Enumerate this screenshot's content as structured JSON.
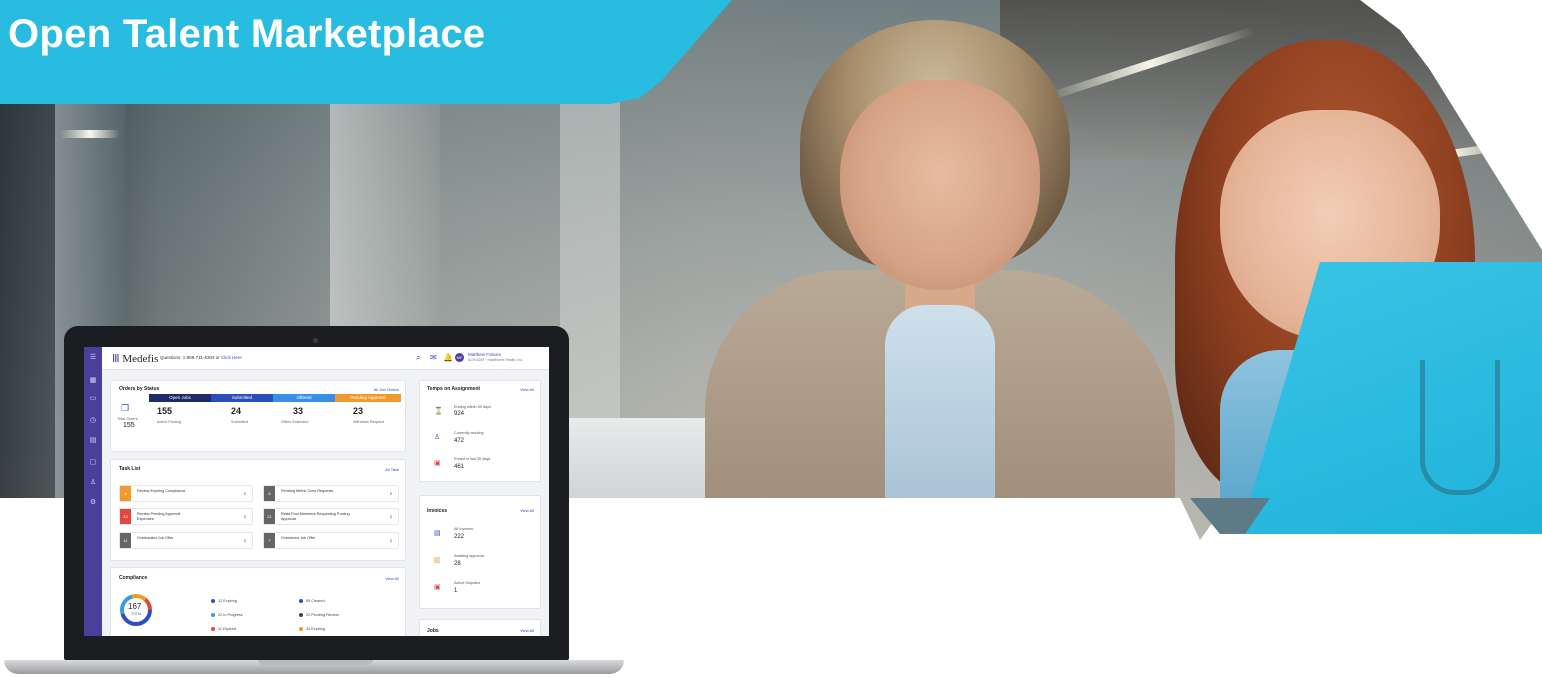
{
  "title": "Open Talent Marketplace",
  "colors": {
    "accent": "#28bde0",
    "rail": "#4a3f9a",
    "link": "#2f4cc4"
  },
  "app": {
    "logo": "Medefis",
    "phone_text": "Questions: 1-866-711-6303 or",
    "click_here": "Click Here",
    "user_name": "Matthew Folsom",
    "user_org": "ACH-6287 · Hawthorne Health, Inc.",
    "avatar_initials": "MF",
    "icons": [
      "search-icon",
      "mail-icon",
      "bell-icon"
    ]
  },
  "sidebar_icons": [
    "grid-icon",
    "briefcase-icon",
    "clock-icon",
    "document-icon",
    "folder-icon",
    "people-icon",
    "gear-icon"
  ],
  "orders": {
    "title": "Orders by Status",
    "link": "All Job Orders",
    "total_label": "Total Orders",
    "total": "155",
    "segments": [
      {
        "label": "Open Jobs",
        "color": "#1f2a6b",
        "value": "155",
        "sub": "Active Posting"
      },
      {
        "label": "Submitted",
        "color": "#2b4fb8",
        "value": "24",
        "sub": "Submitted"
      },
      {
        "label": "Offered",
        "color": "#3a8ee6",
        "value": "33",
        "sub": "Offers Extended"
      },
      {
        "label": "Pending Approval",
        "color": "#f09a2e",
        "value": "23",
        "sub": "Withdraw Request"
      }
    ]
  },
  "tasks": {
    "title": "Task List",
    "link": "All Task",
    "items": [
      {
        "badge": "4",
        "color": "#f09a2e",
        "label": "Review Expiring Compliance",
        "count": "2"
      },
      {
        "badge": "6",
        "color": "#666666",
        "label": "Pending Metric Crew Requests",
        "count": "2"
      },
      {
        "badge": "13",
        "color": "#e0483e",
        "label": "Review Pending Approval Expenses",
        "count": "2"
      },
      {
        "badge": "21",
        "color": "#666666",
        "label": "Read Pool Members Requesting Pooling Approval",
        "count": "2"
      },
      {
        "badge": "11",
        "color": "#666666",
        "label": "Overhauled Job Offer",
        "count": "2"
      },
      {
        "badge": "7",
        "color": "#666666",
        "label": "Overdered Job Offer",
        "count": "2"
      }
    ]
  },
  "compliance": {
    "title": "Compliance",
    "link": "View All",
    "total": "167",
    "total_label": "TOTAL",
    "legend": [
      {
        "label": "12 Expiring",
        "color": "#2f4cc4"
      },
      {
        "label": "55 Cleared",
        "color": "#2f4cc4"
      },
      {
        "label": "22 In Progress",
        "color": "#3a9de0"
      },
      {
        "label": "22 Pending Review",
        "color": "#444444"
      },
      {
        "label": "11 Expired",
        "color": "#e0483e"
      },
      {
        "label": "34 Expiring",
        "color": "#f09a2e"
      }
    ]
  },
  "temps": {
    "title": "Temps on Assignment",
    "link": "View All",
    "items": [
      {
        "label": "Ending within 30 days",
        "value": "924",
        "icon": "hourglass-icon",
        "color": "#f09a2e"
      },
      {
        "label": "Currently working",
        "value": "472",
        "icon": "person-icon",
        "color": "#2f4cc4"
      },
      {
        "label": "Ended in last 30 days",
        "value": "461",
        "icon": "calendar-icon",
        "color": "#e0483e"
      }
    ]
  },
  "invoices": {
    "title": "Invoices",
    "link": "View All",
    "items": [
      {
        "label": "All Invoices",
        "value": "222",
        "icon": "invoice-icon",
        "color": "#2f4cc4"
      },
      {
        "label": "Awaiting approval",
        "value": "28",
        "icon": "clipboard-icon",
        "color": "#f09a2e"
      },
      {
        "label": "Active Disputes",
        "value": "1",
        "icon": "dispute-icon",
        "color": "#e0483e"
      }
    ]
  },
  "jobs": {
    "title": "Jobs",
    "link": "View All"
  }
}
